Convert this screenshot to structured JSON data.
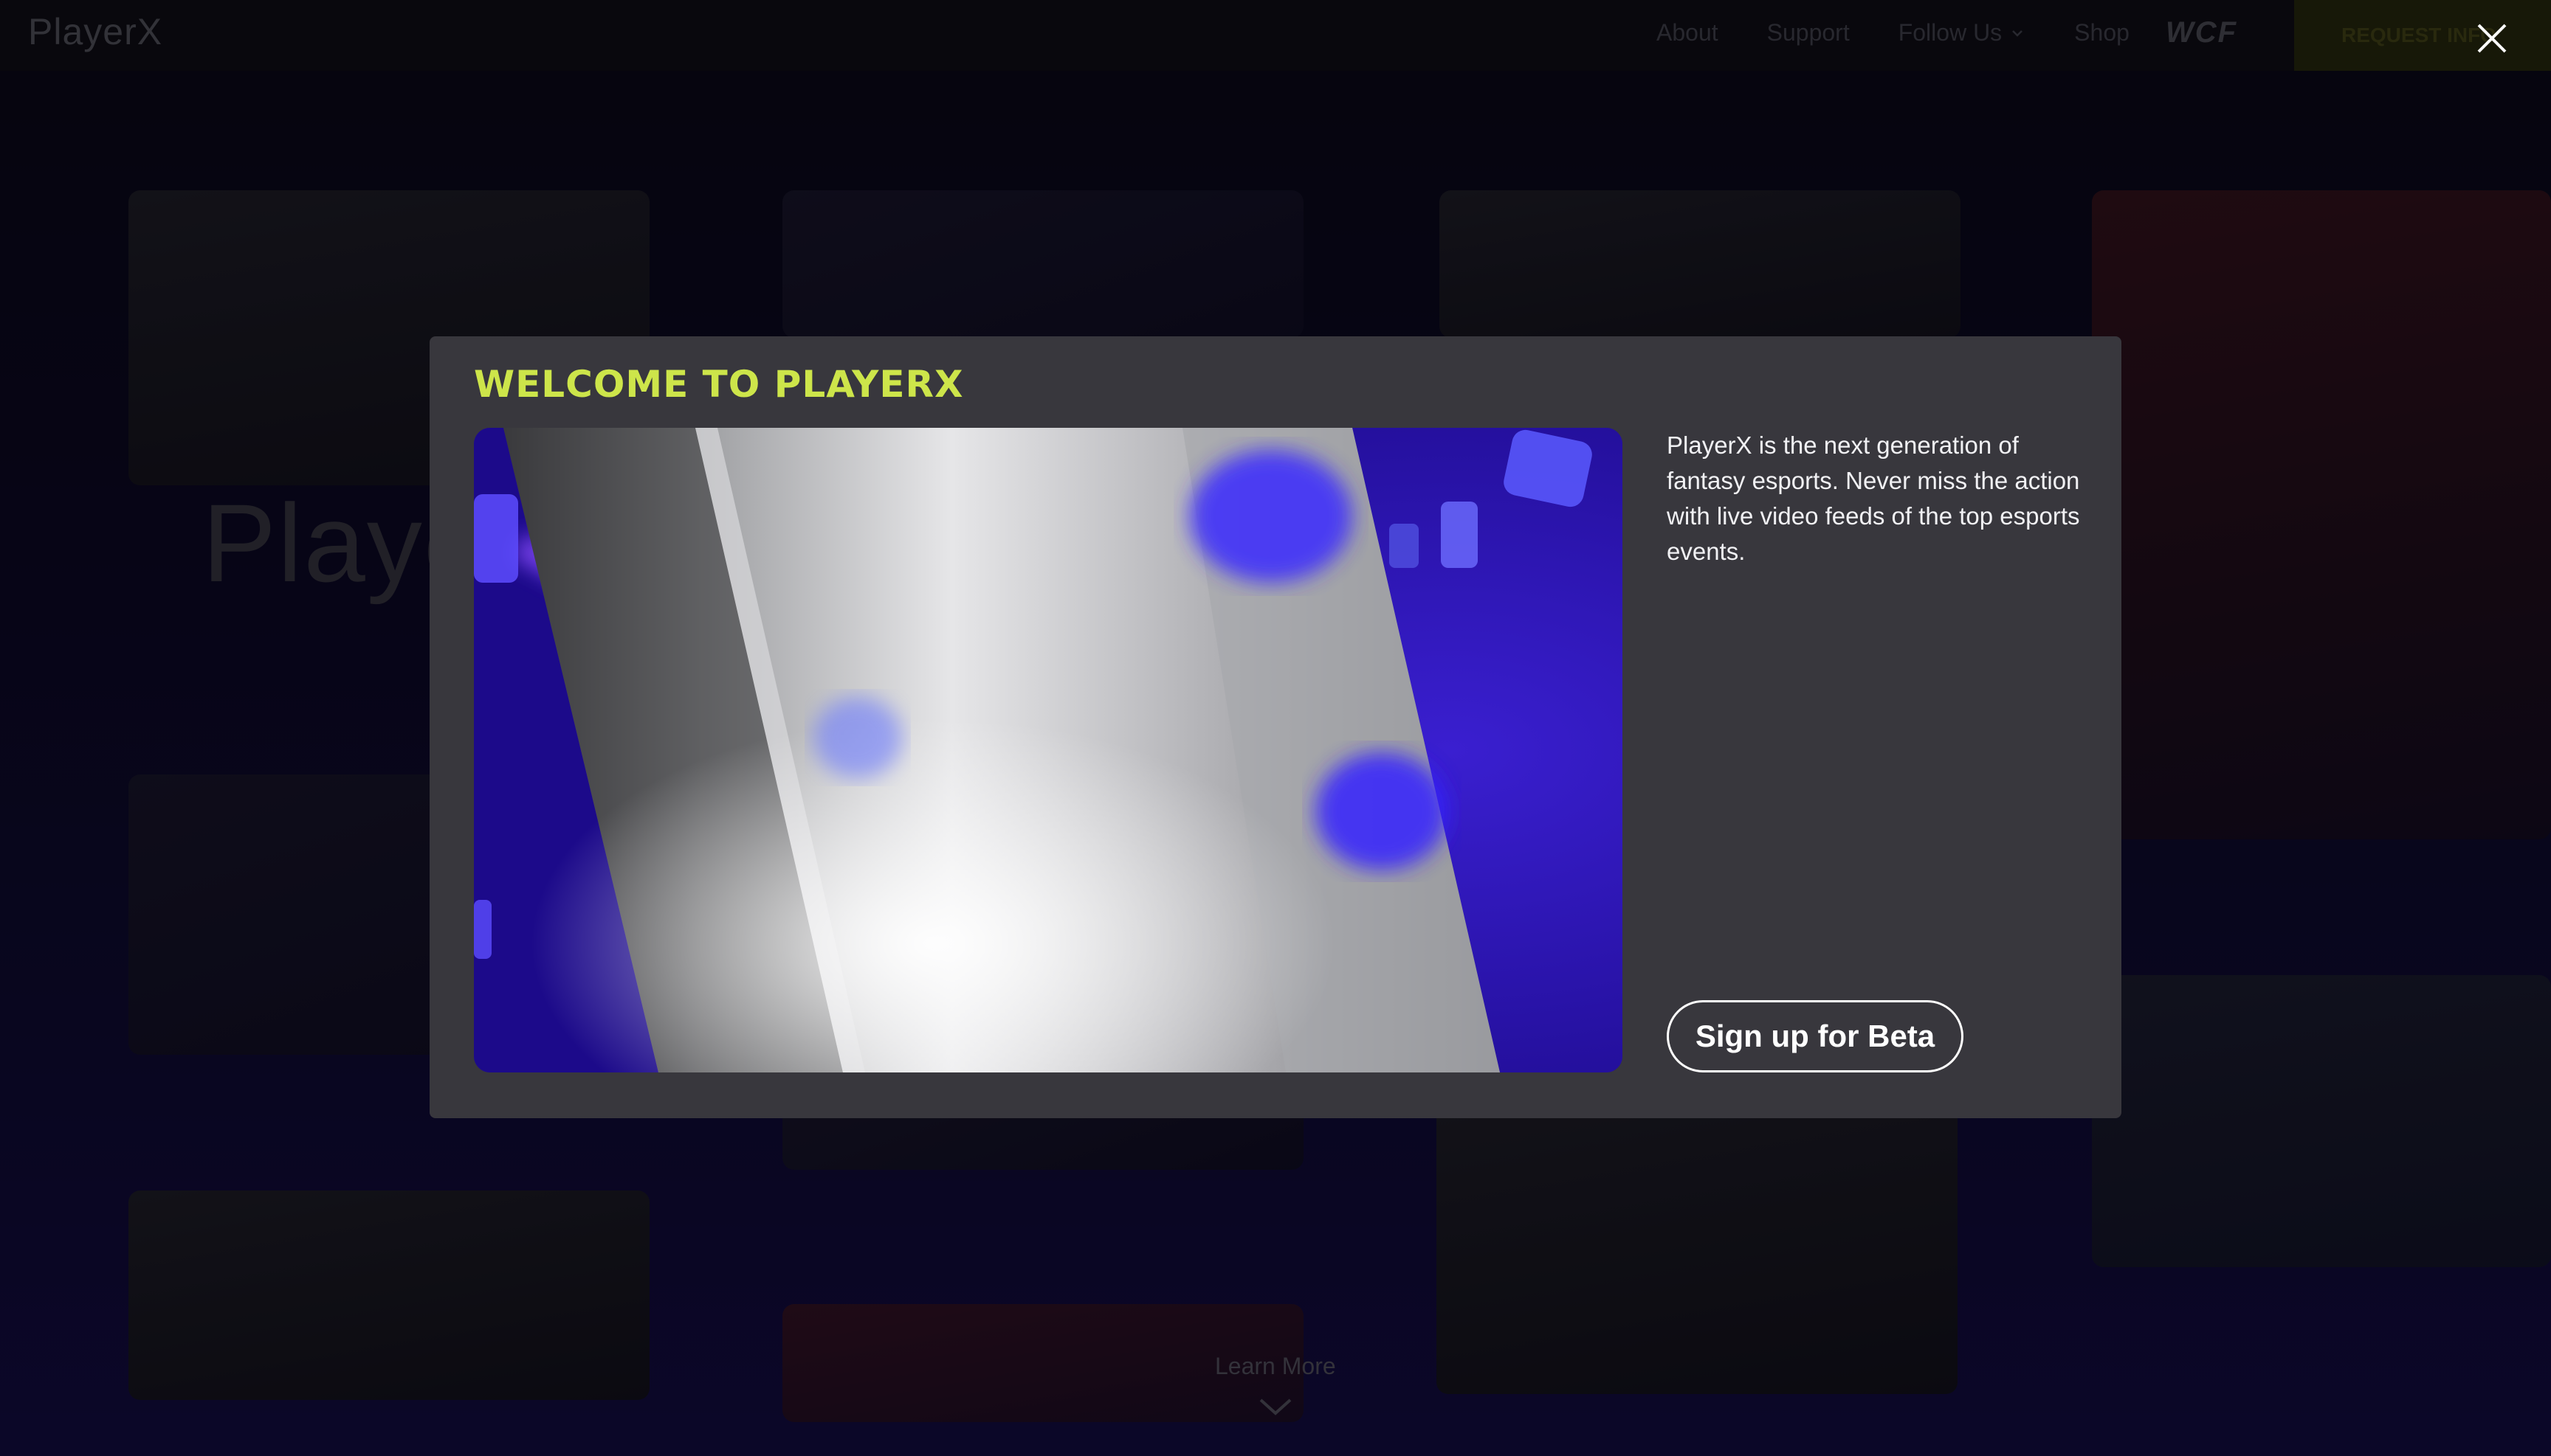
{
  "background": {
    "brand": "PlayerX",
    "nav": {
      "about": "About",
      "support": "Support",
      "follow_us": "Follow Us",
      "shop": "Shop",
      "partner_logo": "WCF",
      "request_button": "REQUEST INFO"
    },
    "hero_title": "Playe",
    "learn_more": "Learn More"
  },
  "modal": {
    "title": "WELCOME TO PLAYERX",
    "description": "PlayerX is the next generation of fantasy esports. Never miss the action with live video feeds of the top esports events.",
    "cta_label": "Sign up for Beta",
    "close_icon": "close-icon",
    "video_icon": "video-frame"
  },
  "colors": {
    "accent": "#cde54a",
    "modal_bg": "#38373d",
    "video_purple": "#2510a0"
  }
}
